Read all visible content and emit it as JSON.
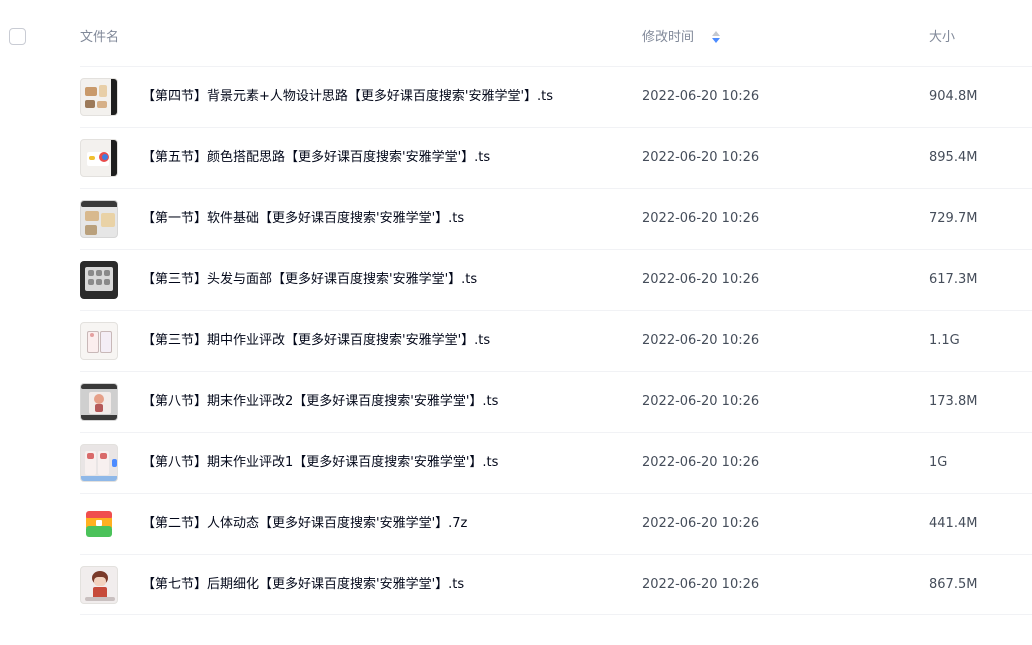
{
  "header": {
    "name_label": "文件名",
    "time_label": "修改时间",
    "size_label": "大小"
  },
  "files": [
    {
      "name": "【第四节】背景元素+人物设计思路【更多好课百度搜索'安雅学堂'】.ts",
      "time": "2022-06-20 10:26",
      "size": "904.8M",
      "icon": "video-thumbnail"
    },
    {
      "name": "【第五节】颜色搭配思路【更多好课百度搜索'安雅学堂'】.ts",
      "time": "2022-06-20 10:26",
      "size": "895.4M",
      "icon": "video-thumbnail"
    },
    {
      "name": "【第一节】软件基础【更多好课百度搜索'安雅学堂'】.ts",
      "time": "2022-06-20 10:26",
      "size": "729.7M",
      "icon": "video-thumbnail"
    },
    {
      "name": "【第三节】头发与面部【更多好课百度搜索'安雅学堂'】.ts",
      "time": "2022-06-20 10:26",
      "size": "617.3M",
      "icon": "video-thumbnail"
    },
    {
      "name": "【第三节】期中作业评改【更多好课百度搜索'安雅学堂'】.ts",
      "time": "2022-06-20 10:26",
      "size": "1.1G",
      "icon": "video-thumbnail"
    },
    {
      "name": "【第八节】期末作业评改2【更多好课百度搜索'安雅学堂'】.ts",
      "time": "2022-06-20 10:26",
      "size": "173.8M",
      "icon": "video-thumbnail"
    },
    {
      "name": "【第八节】期末作业评改1【更多好课百度搜索'安雅学堂'】.ts",
      "time": "2022-06-20 10:26",
      "size": "1G",
      "icon": "video-thumbnail"
    },
    {
      "name": "【第二节】人体动态【更多好课百度搜索'安雅学堂'】.7z",
      "time": "2022-06-20 10:26",
      "size": "441.4M",
      "icon": "archive-icon"
    },
    {
      "name": "【第七节】后期细化【更多好课百度搜索'安雅学堂'】.ts",
      "time": "2022-06-20 10:26",
      "size": "867.5M",
      "icon": "video-thumbnail"
    }
  ],
  "colors": {
    "sort_active": "#4d8cff",
    "sort_inactive": "#c4c8d0",
    "archive_top": "#f04e4e",
    "archive_mid": "#ffb020",
    "archive_bottom": "#4bc25a"
  }
}
